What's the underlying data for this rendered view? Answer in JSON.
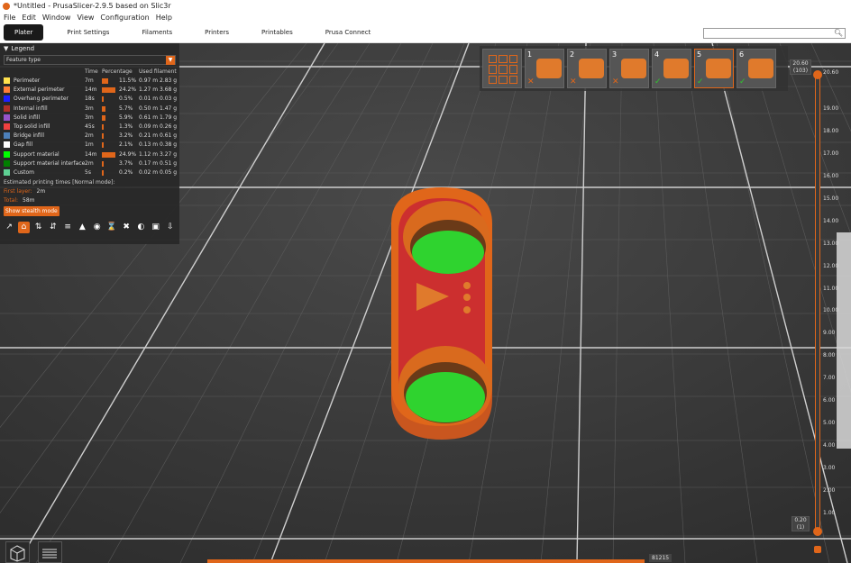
{
  "window": {
    "title": "*Untitled - PrusaSlicer-2.9.5 based on Slic3r"
  },
  "menu": [
    "File",
    "Edit",
    "Window",
    "View",
    "Configuration",
    "Help"
  ],
  "tabs": [
    "Plater",
    "Print Settings",
    "Filaments",
    "Printers",
    "Printables",
    "Prusa Connect"
  ],
  "search": {
    "placeholder": ""
  },
  "legend": {
    "title": "Legend",
    "view_type": "Feature type",
    "columns": {
      "time": "Time",
      "percentage": "Percentage",
      "used": "Used filament"
    },
    "rows": [
      {
        "name": "Perimeter",
        "color": "#ffe14d",
        "time": "7m",
        "pct": "11.5%",
        "len": "0.97 m",
        "weight": "2.83 g",
        "frac": 0.115
      },
      {
        "name": "External perimeter",
        "color": "#ff7d38",
        "time": "14m",
        "pct": "24.2%",
        "len": "1.27 m",
        "weight": "3.68 g",
        "frac": 0.242
      },
      {
        "name": "Overhang perimeter",
        "color": "#1f1fff",
        "time": "18s",
        "pct": "0.5%",
        "len": "0.01 m",
        "weight": "0.03 g",
        "frac": 0.005
      },
      {
        "name": "Internal infill",
        "color": "#b03029",
        "time": "3m",
        "pct": "5.7%",
        "len": "0.50 m",
        "weight": "1.47 g",
        "frac": 0.057
      },
      {
        "name": "Solid infill",
        "color": "#9654cc",
        "time": "3m",
        "pct": "5.9%",
        "len": "0.61 m",
        "weight": "1.79 g",
        "frac": 0.059
      },
      {
        "name": "Top solid infill",
        "color": "#f04040",
        "time": "45s",
        "pct": "1.3%",
        "len": "0.09 m",
        "weight": "0.26 g",
        "frac": 0.013
      },
      {
        "name": "Bridge infill",
        "color": "#4d80ba",
        "time": "2m",
        "pct": "3.2%",
        "len": "0.21 m",
        "weight": "0.61 g",
        "frac": 0.032
      },
      {
        "name": "Gap fill",
        "color": "#ffffff",
        "time": "1m",
        "pct": "2.1%",
        "len": "0.13 m",
        "weight": "0.38 g",
        "frac": 0.021
      },
      {
        "name": "Support material",
        "color": "#00ff00",
        "time": "14m",
        "pct": "24.9%",
        "len": "1.12 m",
        "weight": "3.27 g",
        "frac": 0.249
      },
      {
        "name": "Support material interface",
        "color": "#008000",
        "time": "2m",
        "pct": "3.7%",
        "len": "0.17 m",
        "weight": "0.51 g",
        "frac": 0.037
      },
      {
        "name": "Custom",
        "color": "#5ed194",
        "time": "5s",
        "pct": "0.2%",
        "len": "0.02 m",
        "weight": "0.05 g",
        "frac": 0.002
      }
    ],
    "estimated": "Estimated printing times [Normal mode]:",
    "first_layer_label": "First layer:",
    "first_layer_value": "2m",
    "total_label": "Total:",
    "total_value": "58m",
    "stealth_button": "Show stealth mode"
  },
  "objects": [
    {
      "num": "",
      "status": ""
    },
    {
      "num": "1",
      "status": "x"
    },
    {
      "num": "2",
      "status": "x"
    },
    {
      "num": "3",
      "status": "x"
    },
    {
      "num": "4",
      "status": "ok"
    },
    {
      "num": "5",
      "status": "ok"
    },
    {
      "num": "6",
      "status": "ok"
    }
  ],
  "layer_slider": {
    "top_value": "20.60",
    "top_layer": "(103)",
    "bottom_value": "0.20",
    "bottom_layer": "(1)",
    "ticks": [
      "20.60",
      "19.00",
      "18.00",
      "17.00",
      "16.00",
      "15.00",
      "14.00",
      "13.00",
      "12.00",
      "11.00",
      "10.00",
      "9.00",
      "8.00",
      "7.00",
      "6.00",
      "5.00",
      "4.00",
      "3.00",
      "2.00",
      "1.00"
    ]
  },
  "move_slider": {
    "value": "81215"
  },
  "colors": {
    "accent": "#e0661a",
    "support": "#2fd32f",
    "body": "#e07a2c"
  }
}
